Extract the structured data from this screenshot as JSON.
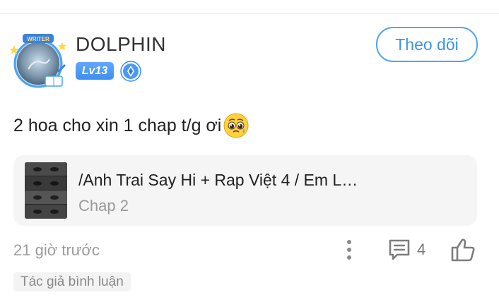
{
  "comment": {
    "user": {
      "name": "DOLPHIN",
      "level": "Lv13",
      "avatar_badge_text": "WRITER"
    },
    "follow_label": "Theo dõi",
    "text": "2 hoa cho xin 1 chap t/g ơi",
    "emoji": "pleading-face",
    "chapter_card": {
      "series_title": "/Anh Trai Say Hi + Rap Việt 4 / Em L…",
      "chapter": "Chap 2"
    },
    "timestamp": "21 giờ trước",
    "reply_count": "4",
    "author_tag": "Tác giả bình luận"
  },
  "colors": {
    "accent_blue": "#3a95e8",
    "level_badge": "#4a9af5",
    "card_background": "#f5f5f5",
    "muted_text": "#9c9c9c"
  },
  "icons": {
    "more": "more-vertical-icon",
    "reply": "comment-icon",
    "like": "thumbs-up-icon",
    "rank": "rank-badge-icon"
  }
}
